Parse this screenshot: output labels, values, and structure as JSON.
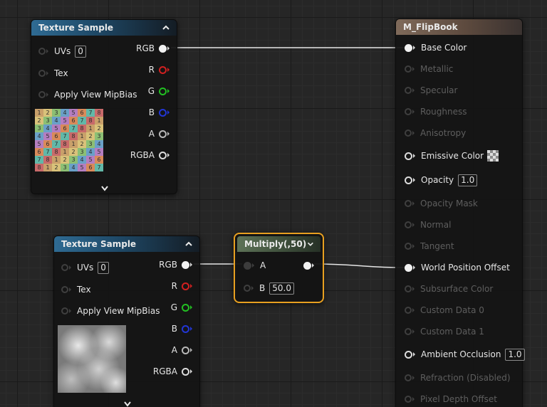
{
  "node_texture_1": {
    "title": "Texture Sample",
    "inputs": [
      {
        "label": "UVs",
        "value": "0"
      },
      {
        "label": "Tex"
      },
      {
        "label": "Apply View MipBias"
      }
    ],
    "outputs": [
      "RGB",
      "R",
      "G",
      "B",
      "A",
      "RGBA"
    ],
    "thumbnail_digits": [
      [
        "1",
        "2",
        "3",
        "4",
        "5",
        "6",
        "7",
        "8"
      ],
      [
        "2",
        "3",
        "4",
        "5",
        "6",
        "7",
        "8",
        "1"
      ],
      [
        "3",
        "4",
        "5",
        "6",
        "7",
        "8",
        "1",
        "2"
      ],
      [
        "4",
        "5",
        "6",
        "7",
        "8",
        "1",
        "2",
        "3"
      ],
      [
        "5",
        "6",
        "7",
        "8",
        "1",
        "2",
        "3",
        "4"
      ],
      [
        "6",
        "7",
        "8",
        "1",
        "2",
        "3",
        "4",
        "5"
      ],
      [
        "7",
        "8",
        "1",
        "2",
        "3",
        "4",
        "5",
        "6"
      ],
      [
        "8",
        "1",
        "2",
        "3",
        "4",
        "5",
        "6",
        "7"
      ]
    ],
    "thumbnail_icon": "uv-checker-texture",
    "expand_icon": "chevron-down-icon"
  },
  "node_texture_2": {
    "title": "Texture Sample",
    "inputs": [
      {
        "label": "UVs",
        "value": "0"
      },
      {
        "label": "Tex"
      },
      {
        "label": "Apply View MipBias"
      }
    ],
    "outputs": [
      "RGB",
      "R",
      "G",
      "B",
      "A",
      "RGBA"
    ],
    "thumbnail_icon": "cloud-noise-texture",
    "expand_icon": "chevron-down-icon"
  },
  "node_multiply": {
    "title": "Multiply(,50)",
    "input_a": "A",
    "input_b": "B",
    "input_b_value": "50.0",
    "selected_color": "#e8a020"
  },
  "material_node": {
    "title": "M_FlipBook",
    "pins": [
      {
        "label": "Base Color",
        "enabled": true,
        "connected": true
      },
      {
        "label": "Metallic",
        "enabled": false
      },
      {
        "label": "Specular",
        "enabled": false
      },
      {
        "label": "Roughness",
        "enabled": false
      },
      {
        "label": "Anisotropy",
        "enabled": false
      },
      {
        "label": "Emissive Color",
        "enabled": true,
        "swatch": "checker"
      },
      {
        "label": "Opacity",
        "enabled": true,
        "value": "1.0"
      },
      {
        "label": "Opacity Mask",
        "enabled": false
      },
      {
        "label": "Normal",
        "enabled": false
      },
      {
        "label": "Tangent",
        "enabled": false
      },
      {
        "label": "World Position Offset",
        "enabled": true,
        "connected": true
      },
      {
        "label": "Subsurface Color",
        "enabled": false
      },
      {
        "label": "Custom Data 0",
        "enabled": false
      },
      {
        "label": "Custom Data 1",
        "enabled": false
      },
      {
        "label": "Ambient Occlusion",
        "enabled": true,
        "value": "1.0"
      },
      {
        "label": "Refraction (Disabled)",
        "enabled": false
      },
      {
        "label": "Pixel Depth Offset",
        "enabled": false
      }
    ]
  },
  "colors": {
    "pin_red": "#d22020",
    "pin_green": "#22c022",
    "pin_blue": "#2236d6",
    "wire": "#e6e6e6"
  }
}
